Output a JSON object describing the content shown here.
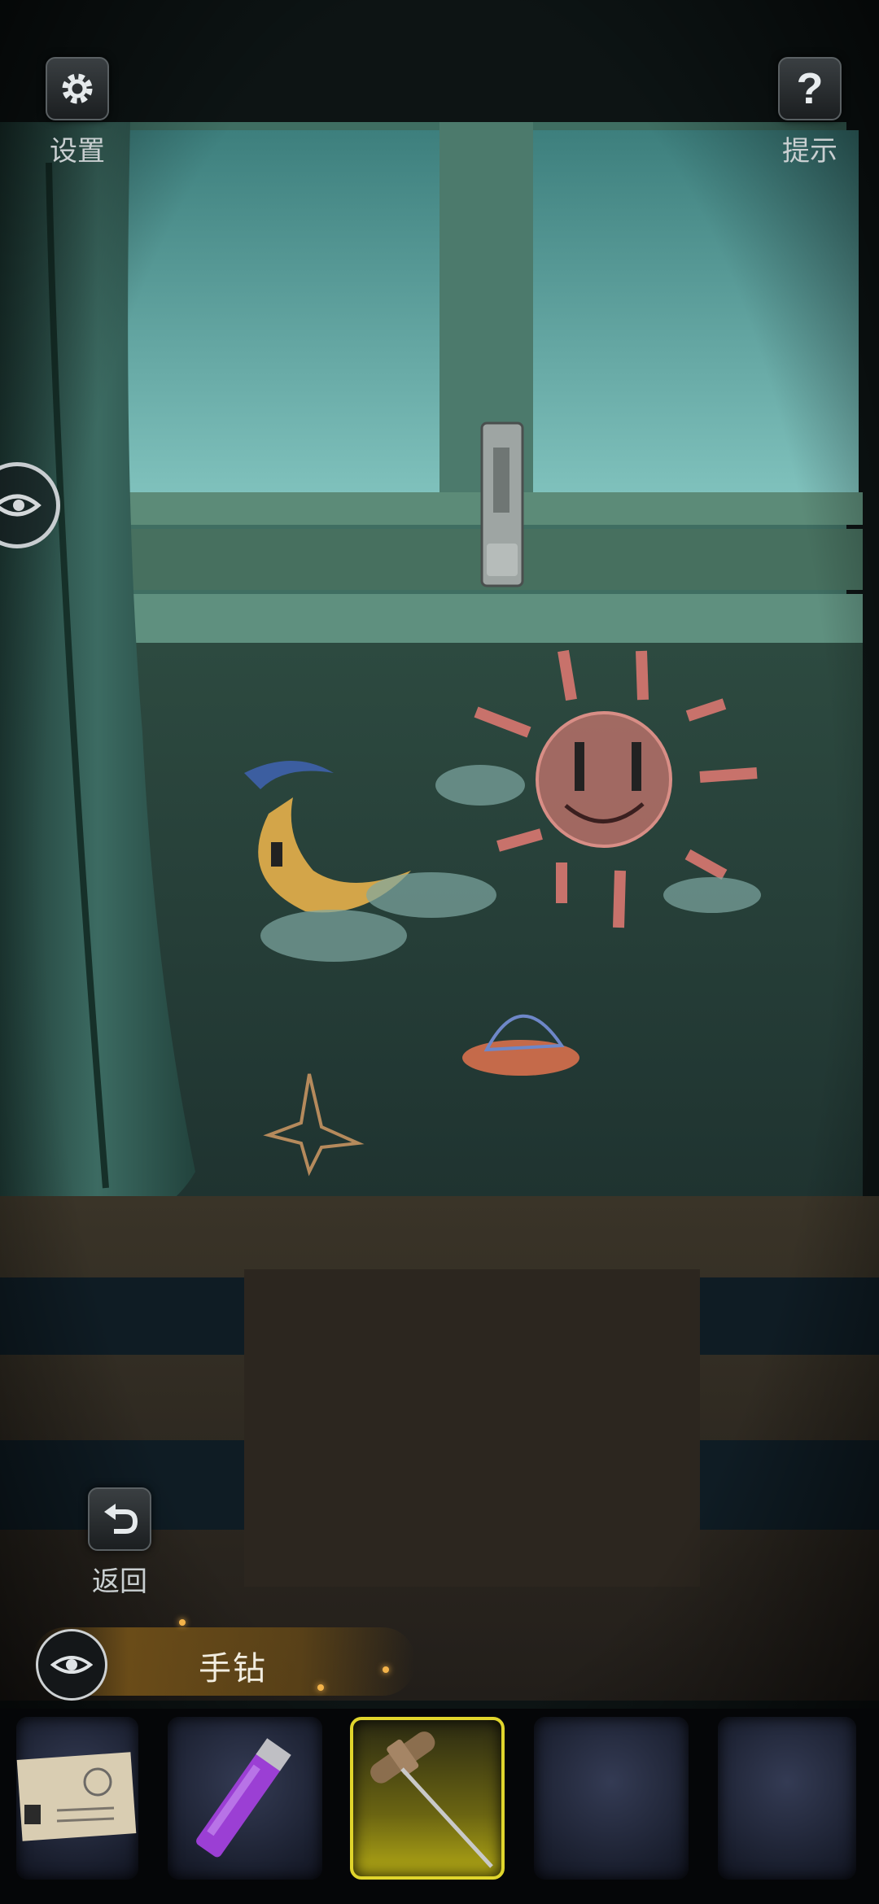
{
  "top_bar": {
    "settings_label": "设置",
    "hint_label": "提示",
    "settings_icon": "gear-icon",
    "hint_icon": "question-mark-icon"
  },
  "back": {
    "label": "返回",
    "icon": "undo-arrow-icon"
  },
  "side_toggle": {
    "icon": "eye-icon"
  },
  "selected_item": {
    "name": "手钻",
    "icon": "eye-icon"
  },
  "inventory": {
    "slots": [
      {
        "content": "postcard",
        "selected": false
      },
      {
        "content": "purple-lighter",
        "selected": false
      },
      {
        "content": "hand-drill",
        "selected": true
      },
      {
        "content": "empty",
        "selected": false
      },
      {
        "content": "empty",
        "selected": false
      }
    ]
  },
  "colors": {
    "ui_text": "#c9cfd1",
    "selection_highlight": "#e0d52c",
    "banner_gold": "#7a5519"
  }
}
